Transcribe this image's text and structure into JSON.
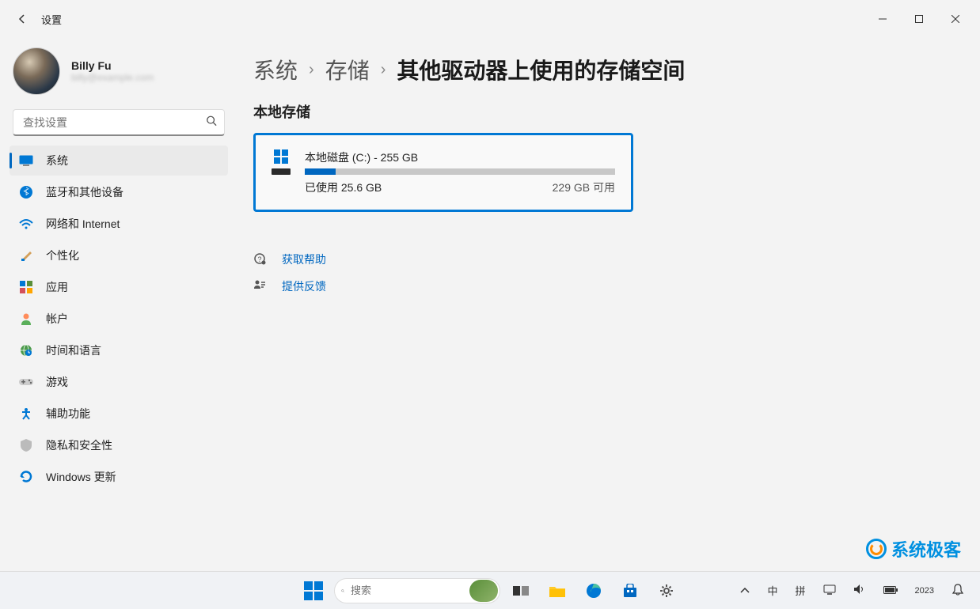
{
  "window": {
    "title": "设置"
  },
  "user": {
    "name": "Billy Fu",
    "sub": "billy@example.com"
  },
  "search": {
    "placeholder": "查找设置"
  },
  "nav": [
    {
      "id": "system",
      "label": "系统",
      "icon": "🖥️",
      "active": true
    },
    {
      "id": "bluetooth",
      "label": "蓝牙和其他设备",
      "icon": "bt"
    },
    {
      "id": "network",
      "label": "网络和 Internet",
      "icon": "wifi"
    },
    {
      "id": "personalization",
      "label": "个性化",
      "icon": "brush"
    },
    {
      "id": "apps",
      "label": "应用",
      "icon": "apps"
    },
    {
      "id": "accounts",
      "label": "帐户",
      "icon": "person"
    },
    {
      "id": "time",
      "label": "时间和语言",
      "icon": "globe"
    },
    {
      "id": "gaming",
      "label": "游戏",
      "icon": "game"
    },
    {
      "id": "accessibility",
      "label": "辅助功能",
      "icon": "access"
    },
    {
      "id": "privacy",
      "label": "隐私和安全性",
      "icon": "shield"
    },
    {
      "id": "update",
      "label": "Windows 更新",
      "icon": "update"
    }
  ],
  "breadcrumb": {
    "part1": "系统",
    "part2": "存储",
    "current": "其他驱动器上使用的存储空间"
  },
  "section": {
    "title": "本地存储"
  },
  "drive": {
    "name": "本地磁盘 (C:) - 255 GB",
    "used_label": "已使用 25.6 GB",
    "free_label": "229 GB 可用",
    "used_pct": 10
  },
  "help": {
    "get_help": "获取帮助",
    "feedback": "提供反馈"
  },
  "watermark": "系统极客",
  "taskbar": {
    "search_placeholder": "搜索",
    "ime1": "中",
    "ime2": "拼",
    "year": "2023"
  }
}
